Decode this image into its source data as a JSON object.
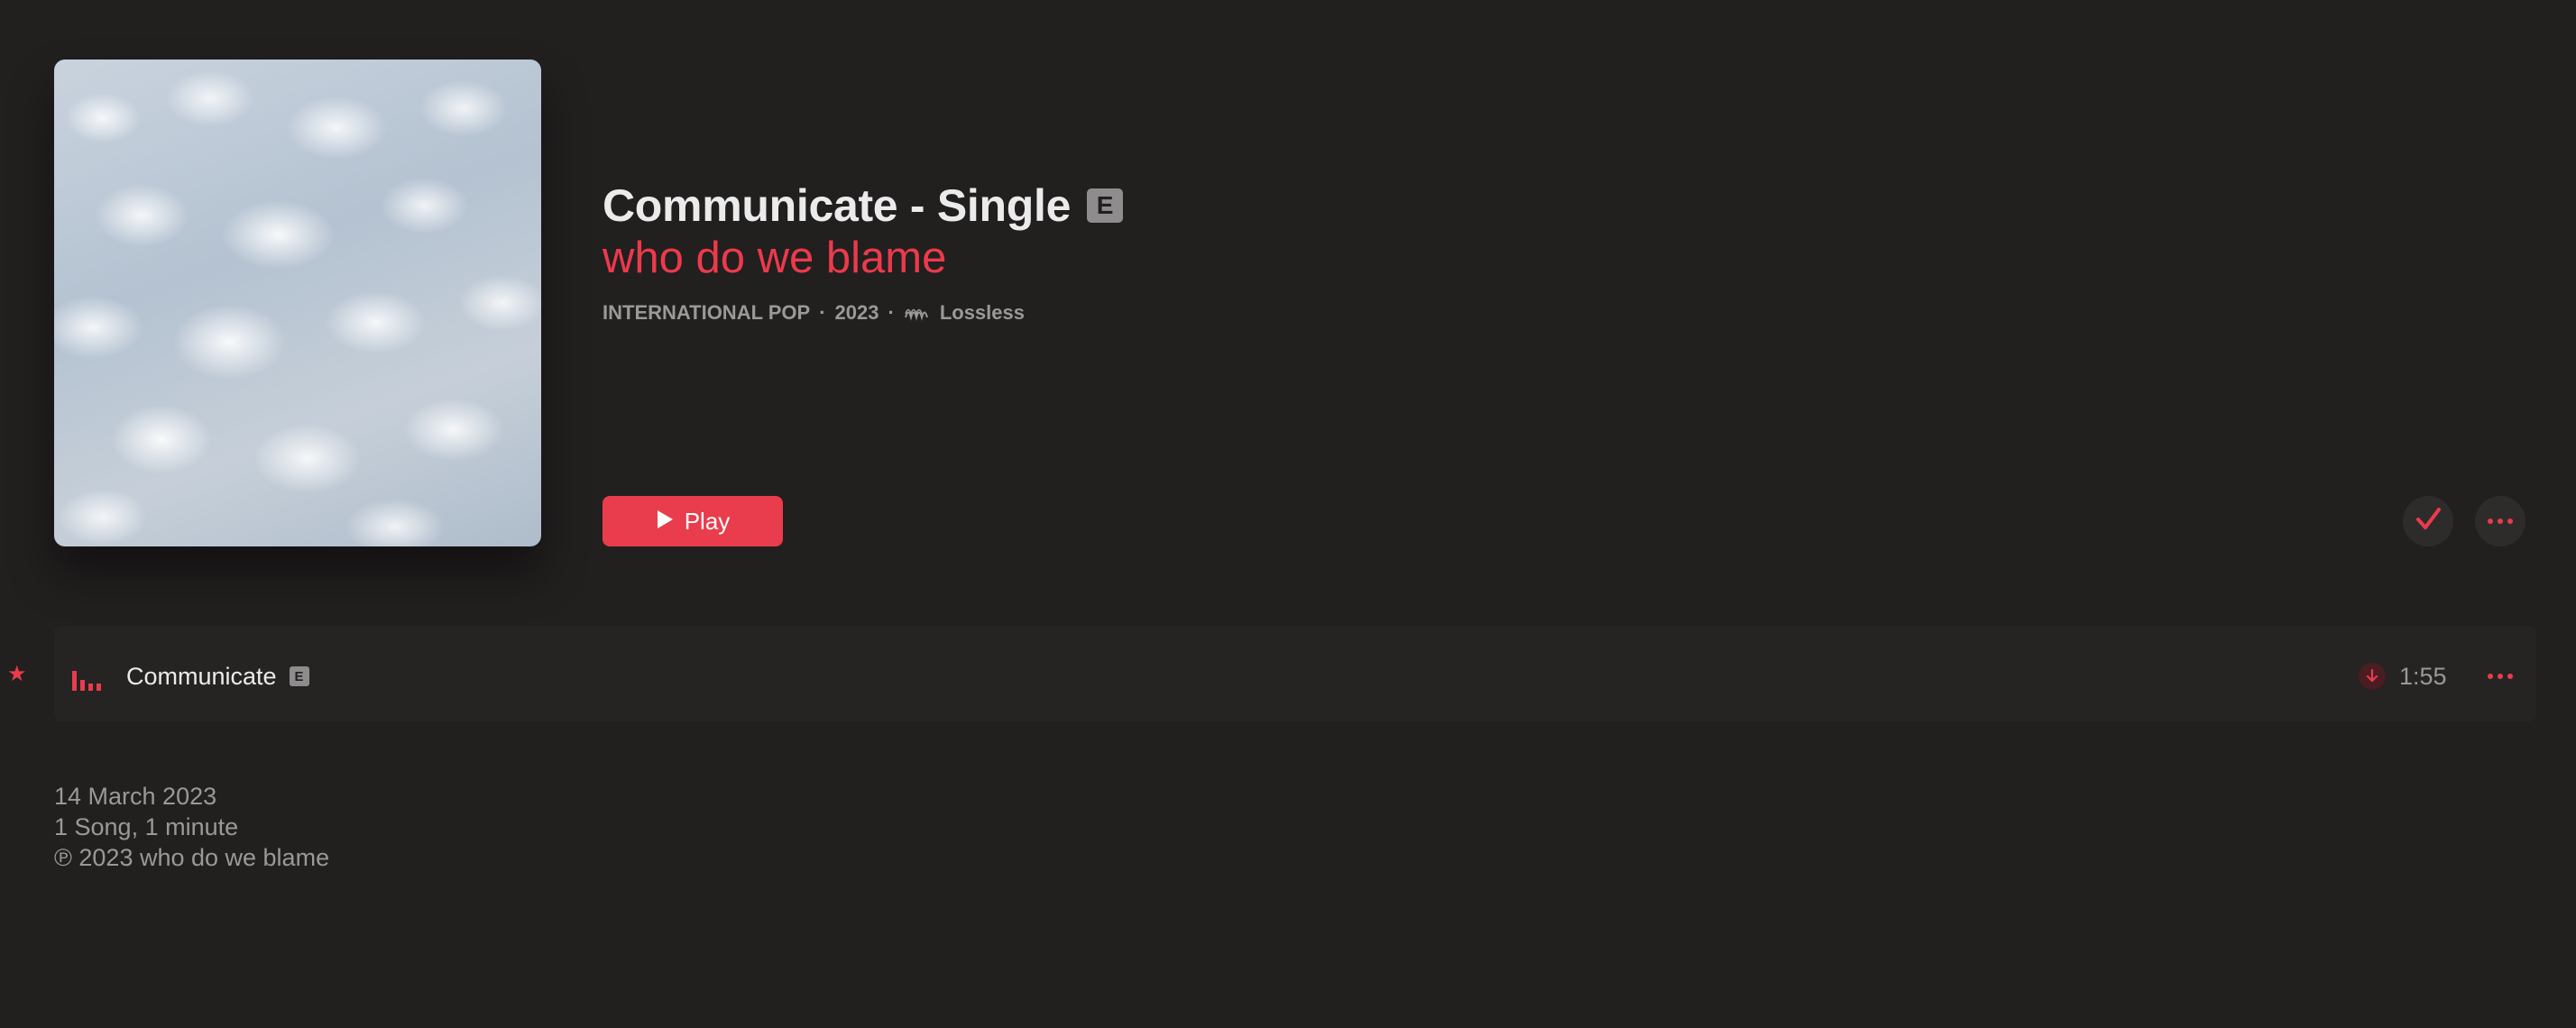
{
  "album": {
    "title": "Communicate - Single",
    "explicit_badge": "E",
    "artist": "who do we blame",
    "genre": "INTERNATIONAL POP",
    "separator": "·",
    "year": "2023",
    "quality": "Lossless",
    "artwork_icon": "clouds-artwork"
  },
  "actions": {
    "play_label": "Play",
    "play_icon": "play-icon",
    "added_icon": "checkmark-icon",
    "more_icon": "more-icon"
  },
  "tracks": [
    {
      "favorite_icon": "star-icon",
      "status_icon": "now-playing-bars-icon",
      "title": "Communicate",
      "explicit_badge": "E",
      "download_icon": "download-icon",
      "duration": "1:55"
    }
  ],
  "footer": {
    "release_date": "14 March 2023",
    "summary": "1 Song, 1 minute",
    "copyright": "℗ 2023 who do we blame"
  },
  "colors": {
    "background": "#221f1f",
    "accent": "#e93c4c",
    "primary_text": "#ebebeb",
    "secondary_text": "#9a9898",
    "row_background": "#262323"
  }
}
